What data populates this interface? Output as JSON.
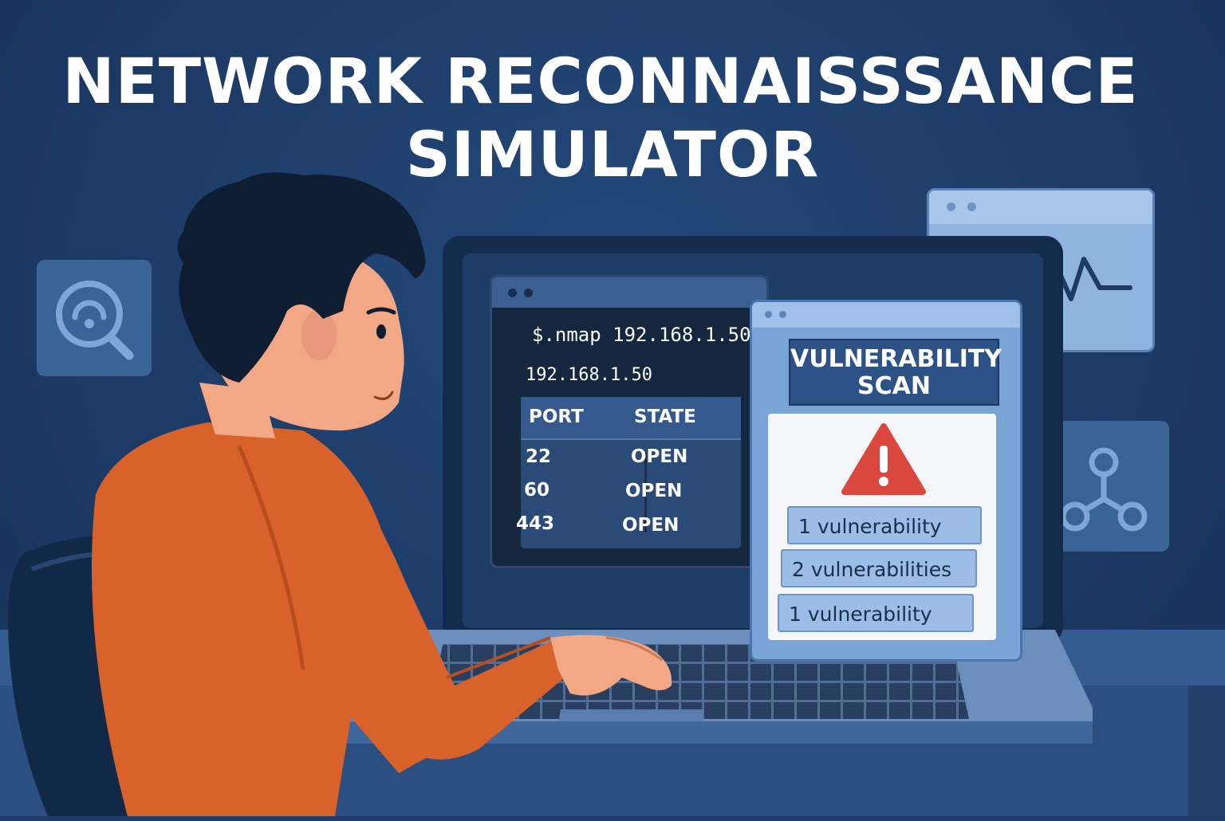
{
  "title": {
    "line1": "NETWORK RECONNAISSSANCE",
    "line2": "SIMULATOR"
  },
  "terminal": {
    "command": "$.nmap 192.168.1.50",
    "host": "192.168.1.50",
    "headers": [
      "PORT",
      "STATE"
    ],
    "rows": [
      {
        "port": "22",
        "state": "OPEN"
      },
      {
        "port": "60",
        "state": "OPEN"
      },
      {
        "port": "443",
        "state": "OPEN"
      }
    ]
  },
  "scan": {
    "title_line1": "VULNERABILITY",
    "title_line2": "SCAN",
    "items": [
      "1  vulnerability",
      "2  vulnerabilities",
      "1  vulnerability"
    ]
  },
  "icons": {
    "left_tile": "search-radar-icon",
    "right_tile": "network-node-icon",
    "activity": "heartbeat-line-icon",
    "warning": "warning-triangle-icon"
  },
  "colors": {
    "background": "#1d3b66",
    "shirt": "#d9622b",
    "warning": "#d9473d",
    "title": "#ffffff"
  }
}
